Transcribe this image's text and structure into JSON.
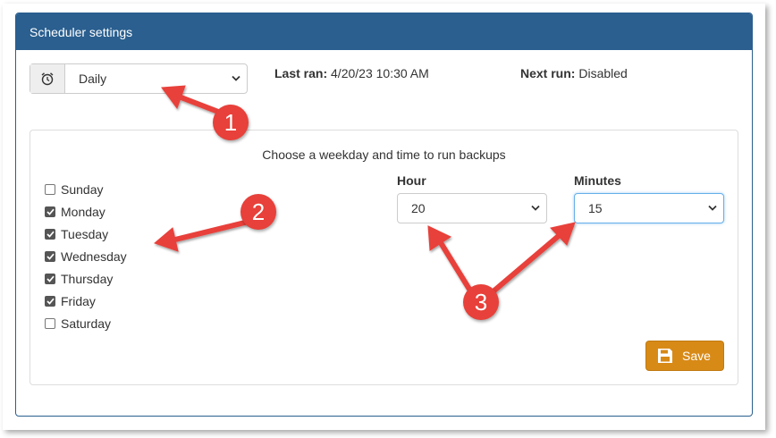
{
  "panel": {
    "title": "Scheduler settings"
  },
  "frequency": {
    "icon": "alarm-clock-icon",
    "value": "Daily"
  },
  "status": {
    "last_ran_label": "Last ran:",
    "last_ran_value": "4/20/23 10:30 AM",
    "next_run_label": "Next run:",
    "next_run_value": "Disabled"
  },
  "schedule": {
    "title": "Choose a weekday and time to run backups",
    "days": [
      {
        "label": "Sunday",
        "checked": false
      },
      {
        "label": "Monday",
        "checked": true
      },
      {
        "label": "Tuesday",
        "checked": true
      },
      {
        "label": "Wednesday",
        "checked": true
      },
      {
        "label": "Thursday",
        "checked": true
      },
      {
        "label": "Friday",
        "checked": true
      },
      {
        "label": "Saturday",
        "checked": false
      }
    ],
    "hour_label": "Hour",
    "hour_value": "20",
    "minutes_label": "Minutes",
    "minutes_value": "15",
    "save_label": "Save"
  },
  "annotations": {
    "badge_1": "1",
    "badge_2": "2",
    "badge_3": "3",
    "arrow_color": "#e8403a"
  }
}
